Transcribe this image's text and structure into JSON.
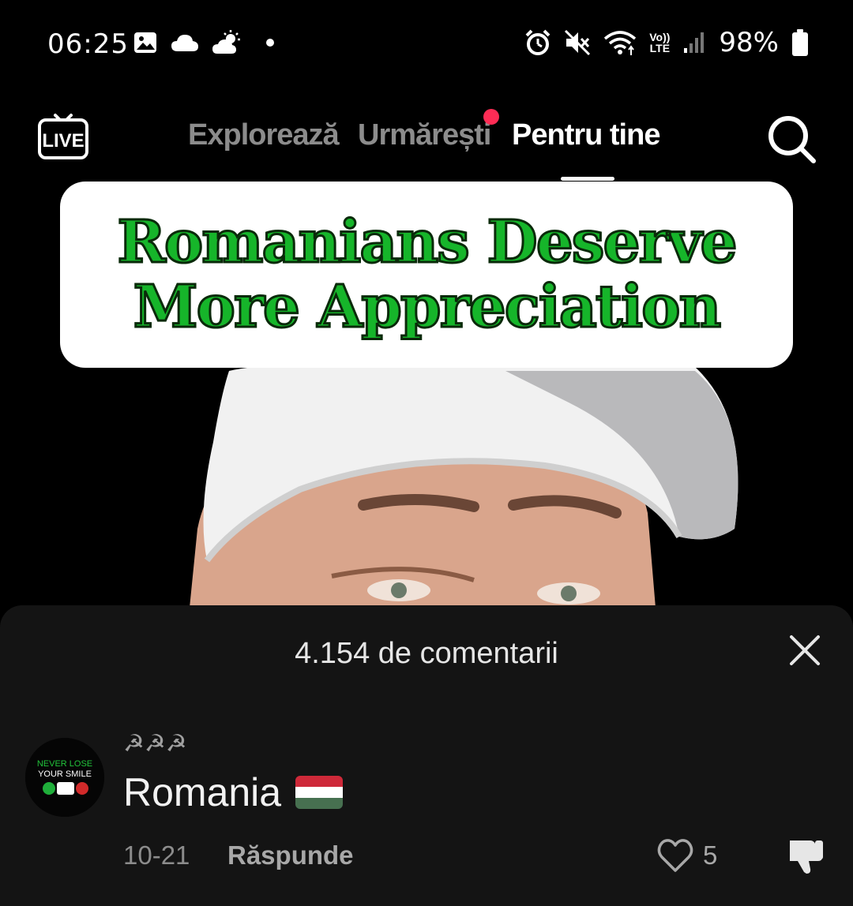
{
  "status_bar": {
    "time": "06:25",
    "battery": "98%",
    "network_top": "Vo))",
    "network_bottom": "LTE",
    "left_icons": [
      "image-icon",
      "cloud-icon",
      "weather-icon",
      "dot-icon"
    ],
    "right_icons": [
      "alarm-icon",
      "mute-icon",
      "wifi-icon",
      "signal-icon",
      "battery-icon"
    ]
  },
  "top_nav": {
    "live_label": "LIVE",
    "tabs": [
      {
        "label": "Explorează"
      },
      {
        "label": "Urmărești"
      },
      {
        "label": "Pentru tine"
      }
    ],
    "active_tab": "Pentru tine",
    "accent_color": "#fe2c55"
  },
  "video": {
    "title_line1": "Romanians Deserve",
    "title_line2": "More Appreciation",
    "title_color": "#16b52a"
  },
  "comments": {
    "header": "4.154 de comentarii",
    "items": [
      {
        "username": "☭☭☭",
        "text": "Romania",
        "avatar_text": [
          "NEVER LOSE",
          "YOUR SMILE"
        ],
        "date": "10-21",
        "reply_label": "Răspunde",
        "likes": "5"
      }
    ]
  }
}
